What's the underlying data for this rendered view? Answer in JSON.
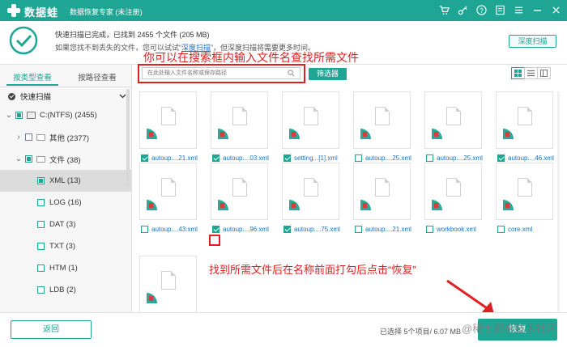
{
  "titlebar": {
    "app_name": "数据蛙",
    "subtitle": "数据恢复专家 (未注册)"
  },
  "scan_info": {
    "line1": "快速扫描已完成，已找到 2455 个文件 (205 MB)",
    "line2_prefix": "如果您找不到丢失的文件，您可以试试“",
    "line2_link": "深度扫描",
    "line2_suffix": "”，但深度扫描将需要更多时间。",
    "deep_scan_button": "深度扫描"
  },
  "left_panel": {
    "tabs": [
      "按类型查看",
      "按路径查看"
    ],
    "quick_scan": "快速扫描",
    "tree": [
      {
        "label": "C:(NTFS) (2455)"
      },
      {
        "label": "其他 (2377)"
      },
      {
        "label": "文件 (38)"
      },
      {
        "label": "XML (13)"
      },
      {
        "label": "LOG (16)"
      },
      {
        "label": "DAT (3)"
      },
      {
        "label": "TXT (3)"
      },
      {
        "label": "HTM (1)"
      },
      {
        "label": "LDB (2)"
      }
    ]
  },
  "toolbar": {
    "search_placeholder": "在此处输入文件名称或保存路径",
    "filter_button": "筛选器"
  },
  "annotations": {
    "search_hint": "你可以在搜索框内输入文件名查找所需文件",
    "select_hint": "找到所需文件后在名称前面打勾后点击“恢复”"
  },
  "files": [
    {
      "name": "autoup....21.xml",
      "checked": true
    },
    {
      "name": "autoup....03.xml",
      "checked": true
    },
    {
      "name": "setting...[1].xml",
      "checked": true
    },
    {
      "name": "autoup....25.xml",
      "checked": false
    },
    {
      "name": "autoup....25.xml",
      "checked": false
    },
    {
      "name": "autoup....46.xml",
      "checked": true
    },
    {
      "name": "autoup....43.xml",
      "checked": false
    },
    {
      "name": "autoup....96.xml",
      "checked": true
    },
    {
      "name": "autoup....75.xml",
      "checked": true
    },
    {
      "name": "autoup....21.xml",
      "checked": false
    },
    {
      "name": "workbook.xml",
      "checked": false
    },
    {
      "name": "core.xml",
      "checked": false
    },
    {
      "name": "",
      "checked": false
    }
  ],
  "bottom": {
    "back_button": "返回",
    "status": "已选择 5个项目/ 6.07 MB",
    "recover_button": "恢复",
    "watermark": "@稀土掘金技术社区"
  },
  "colors": {
    "accent": "#1fa594",
    "annotation_red": "#e02020",
    "link_blue": "#1a73c9"
  }
}
